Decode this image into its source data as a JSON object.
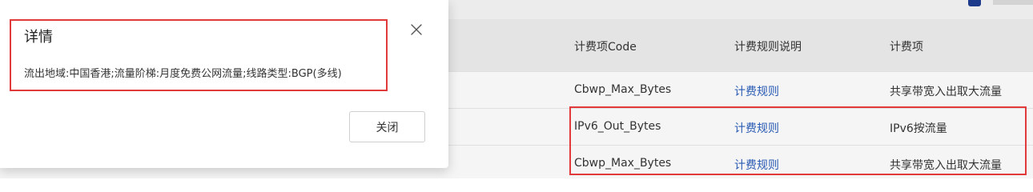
{
  "table": {
    "headers": {
      "code": "计费项Code",
      "rule": "计费规则说明",
      "item": "计费项"
    },
    "rows": [
      {
        "code": "Cbwp_Max_Bytes",
        "rule": "计费规则",
        "item": "共享带宽入出取大流量"
      },
      {
        "code": "IPv6_Out_Bytes",
        "rule": "计费规则",
        "item": "IPv6按流量"
      },
      {
        "code": "Cbwp_Max_Bytes",
        "rule": "计费规则",
        "item": "共享带宽入出取大流量"
      }
    ]
  },
  "modal": {
    "title": "详情",
    "body": "流出地域:中国香港;流量阶梯:月度免费公网流量;线路类型:BGP(多线)",
    "close_button": "关闭",
    "close_icon": "close-icon"
  },
  "colors": {
    "link": "#2a5bb4",
    "highlight": "#e03a3a",
    "checkbox": "#1e3a8a"
  }
}
